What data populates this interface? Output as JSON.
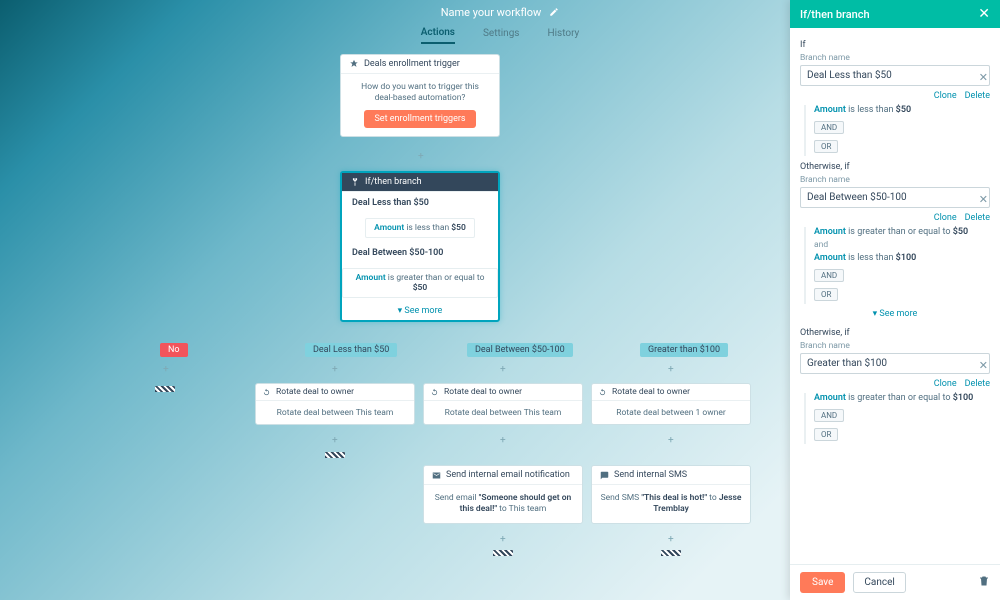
{
  "header": {
    "title": "Name your workflow"
  },
  "tabs": {
    "actions": "Actions",
    "settings": "Settings",
    "history": "History"
  },
  "trigger": {
    "title": "Deals enrollment trigger",
    "prompt": "How do you want to trigger this deal-based automation?",
    "button": "Set enrollment triggers"
  },
  "ifcard": {
    "title": "If/then branch",
    "b1": "Deal Less than $50",
    "c1_amt": "Amount",
    "c1_txt": "is less than",
    "c1_val": "$50",
    "b2": "Deal Between $50-100",
    "c2_amt": "Amount",
    "c2_txt": "is greater than or equal to",
    "c2_val": "$50",
    "see_more": "See more"
  },
  "pills": {
    "no": "No",
    "p1": "Deal Less than $50",
    "p2": "Deal Between $50-100",
    "p3": "Greater than $100"
  },
  "rotate": {
    "title": "Rotate deal to owner",
    "r1": "Rotate deal between This team",
    "r2": "Rotate deal between This team",
    "r3": "Rotate deal between 1 owner"
  },
  "email": {
    "title": "Send internal email notification",
    "pre": "Send email ",
    "q": "\"Someone should get on this deal!\"",
    "to": " to This team"
  },
  "sms": {
    "title": "Send internal SMS",
    "pre": "Send SMS ",
    "q": "\"This deal is hot!\"",
    "mid": " to ",
    "who": "Jesse Tremblay"
  },
  "panel": {
    "header": "If/then branch",
    "if": "If",
    "branch_name_lbl": "Branch name",
    "b1_name": "Deal Less than $50",
    "clone": "Clone",
    "delete": "Delete",
    "b1_amt": "Amount",
    "b1_txt": " is less than ",
    "b1_val": "$50",
    "and": "AND",
    "or": "OR",
    "otherwise": "Otherwise, if",
    "b2_name": "Deal Between $50-100",
    "b2a_amt": "Amount",
    "b2a_txt": " is greater than or equal to ",
    "b2a_val": "$50",
    "b2_join": "and",
    "b2b_amt": "Amount",
    "b2b_txt": " is less than ",
    "b2b_val": "$100",
    "see_more": "See more",
    "b3_name": "Greater than $100",
    "b3_amt": "Amount",
    "b3_txt": " is greater than or equal to ",
    "b3_val": "$100",
    "save": "Save",
    "cancel": "Cancel"
  }
}
